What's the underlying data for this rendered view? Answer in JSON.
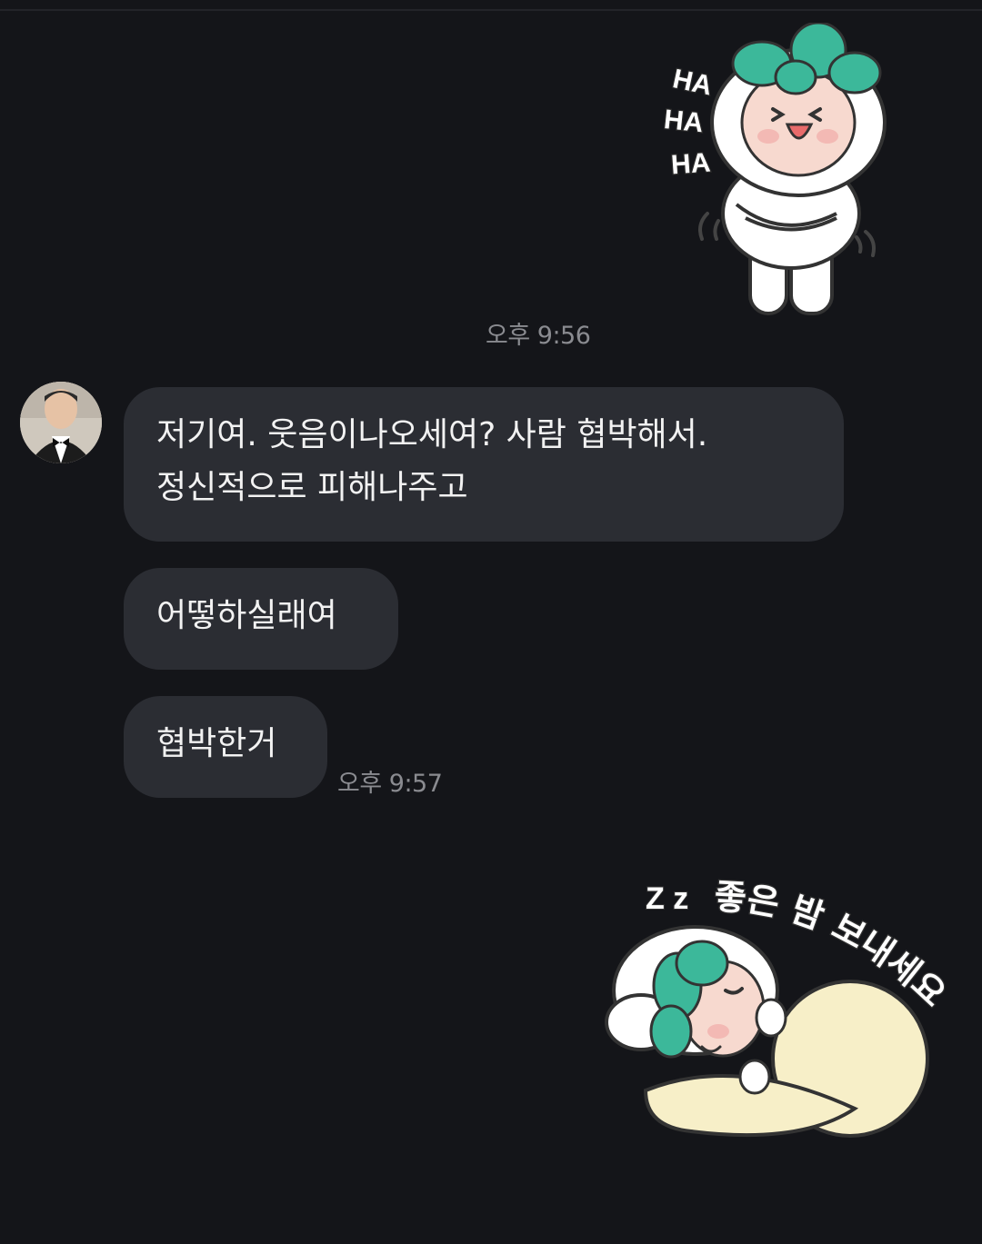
{
  "sticker_top": {
    "icon": "laughing-radish-character-sticker",
    "text_lines": [
      "HA",
      "HA",
      "HA"
    ]
  },
  "timestamp_1": "오후 9:56",
  "avatar": {
    "icon": "profile-photo-man-in-tuxedo"
  },
  "messages": [
    {
      "lines": [
        "저기여. 웃음이나오세여? 사람 협박해서.",
        "정신적으로 피해나주고"
      ]
    },
    {
      "lines": [
        "어떻하실래여"
      ]
    },
    {
      "lines": [
        "협박한거"
      ]
    }
  ],
  "timestamp_2": "오후 9:57",
  "sticker_bottom": {
    "icon": "sleeping-radish-character-sticker",
    "zz": "Z z",
    "text": "좋은 밤 보내세요"
  }
}
